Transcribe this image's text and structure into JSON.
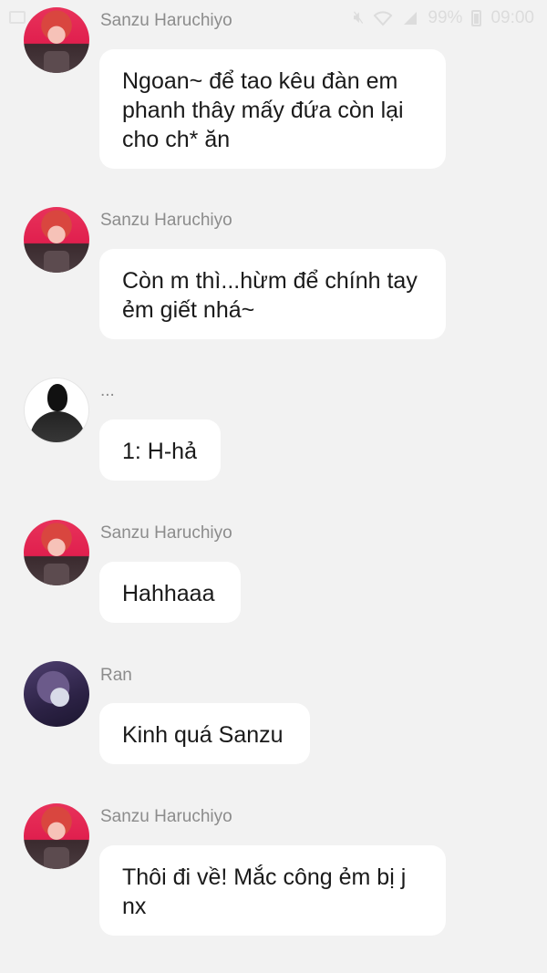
{
  "status_bar": {
    "battery": "99%",
    "time": "09:00",
    "icons": [
      "mute-icon",
      "wifi-icon",
      "signal-icon",
      "battery-icon"
    ]
  },
  "messages": [
    {
      "sender": "Sanzu Haruchiyo",
      "text": "Ngoan~ để tao kêu đàn em phanh thây mấy đứa còn lại cho ch* ăn"
    },
    {
      "sender": "Sanzu Haruchiyo",
      "text": "Còn m thì...hừm để chính tay ẻm giết nhá~"
    },
    {
      "sender": "...",
      "text": "1: H-hả"
    },
    {
      "sender": "Sanzu Haruchiyo",
      "text": "Hahhaaa"
    },
    {
      "sender": "Ran",
      "text": "Kinh quá Sanzu"
    },
    {
      "sender": "Sanzu Haruchiyo",
      "text": "Thôi đi về! Mắc công ẻm bị j nx"
    }
  ]
}
